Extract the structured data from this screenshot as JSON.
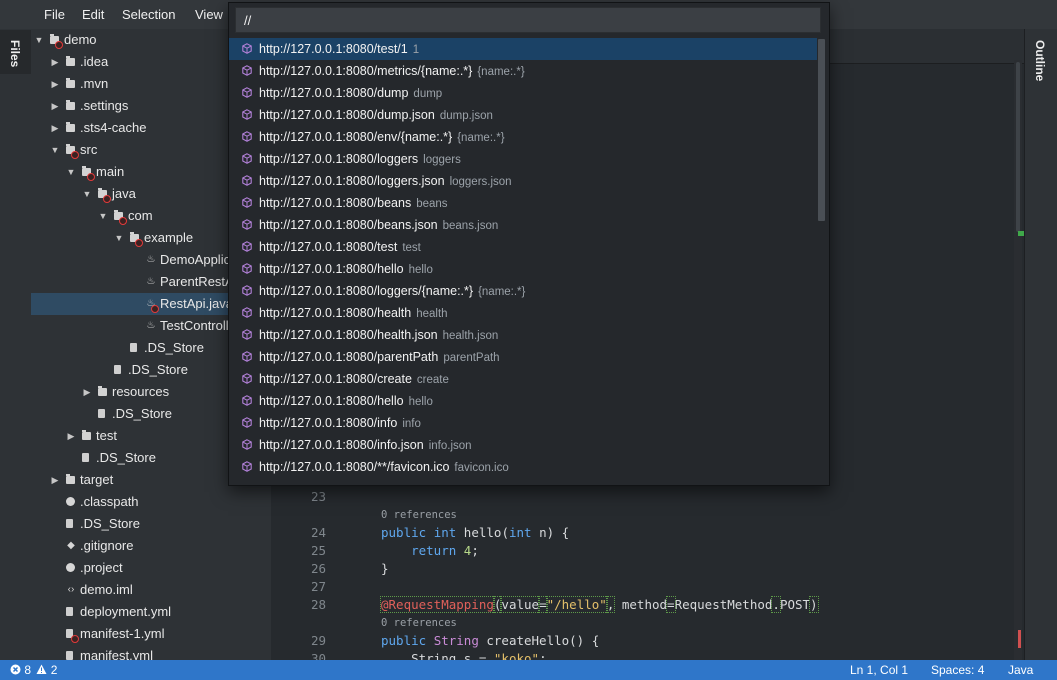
{
  "menu": [
    "File",
    "Edit",
    "Selection",
    "View"
  ],
  "sidebar": {
    "files_tab": "Files",
    "outline_tab": "Outline"
  },
  "tree": [
    {
      "label": "demo",
      "type": "folder",
      "twisty": "open",
      "error": true
    },
    {
      "label": ".idea",
      "type": "folder",
      "twisty": "closed"
    },
    {
      "label": ".mvn",
      "type": "folder",
      "twisty": "closed"
    },
    {
      "label": ".settings",
      "type": "folder",
      "twisty": "closed"
    },
    {
      "label": ".sts4-cache",
      "type": "folder",
      "twisty": "closed"
    },
    {
      "label": "src",
      "type": "folder",
      "twisty": "open",
      "error": true
    },
    {
      "label": "main",
      "type": "folder",
      "twisty": "open",
      "error": true
    },
    {
      "label": "java",
      "type": "folder",
      "twisty": "open",
      "error": true
    },
    {
      "label": "com",
      "type": "folder",
      "twisty": "open",
      "error": true
    },
    {
      "label": "example",
      "type": "folder",
      "twisty": "open",
      "error": true
    },
    {
      "label": "DemoApplic",
      "type": "java"
    },
    {
      "label": "ParentRestA",
      "type": "java"
    },
    {
      "label": "RestApi.java",
      "type": "java",
      "error": true,
      "selected": true
    },
    {
      "label": "TestControlle",
      "type": "java"
    },
    {
      "label": ".DS_Store",
      "type": "file"
    },
    {
      "label": ".DS_Store",
      "type": "file"
    },
    {
      "label": "resources",
      "type": "folder",
      "twisty": "closed"
    },
    {
      "label": ".DS_Store",
      "type": "file"
    },
    {
      "label": "test",
      "type": "folder",
      "twisty": "closed"
    },
    {
      "label": ".DS_Store",
      "type": "file"
    },
    {
      "label": "target",
      "type": "folder",
      "twisty": "closed"
    },
    {
      "label": ".classpath",
      "type": "dot"
    },
    {
      "label": ".DS_Store",
      "type": "file"
    },
    {
      "label": ".gitignore",
      "type": "git"
    },
    {
      "label": ".project",
      "type": "dot"
    },
    {
      "label": "demo.iml",
      "type": "code"
    },
    {
      "label": "deployment.yml",
      "type": "yml"
    },
    {
      "label": "manifest-1.yml",
      "type": "yml",
      "error": true
    },
    {
      "label": "manifest.yml",
      "type": "yml"
    }
  ],
  "code": {
    "refs_label": "0 references",
    "lines": [
      {
        "n": "23"
      },
      {
        "n": "24"
      },
      {
        "n": "25"
      },
      {
        "n": "26"
      },
      {
        "n": "27"
      },
      {
        "n": "28"
      },
      {
        "n": "29"
      },
      {
        "n": "30"
      }
    ],
    "tokens": {
      "public": "public",
      "int": "int",
      "hello": "hello",
      "int_n": "int",
      "params_n": " n) {",
      "return": "return",
      "four": "4",
      "close": "}",
      "annotation": "@RequestMapping",
      "value_key": "value",
      "value_str": "\"/hello\"",
      "method_key": "method",
      "request_method": "RequestMethod",
      "post": "POST",
      "string_type": "String",
      "create_hello": "createHello() {",
      "string_s": "String s = ",
      "koko": "\"koko\"",
      "semi": ";"
    }
  },
  "palette": {
    "query": "//",
    "items": [
      {
        "url": "http://127.0.0.1:8080/test/1",
        "desc": "1"
      },
      {
        "url": "http://127.0.0.1:8080/metrics/{name:.*}",
        "desc": "{name:.*}"
      },
      {
        "url": "http://127.0.0.1:8080/dump",
        "desc": "dump"
      },
      {
        "url": "http://127.0.0.1:8080/dump.json",
        "desc": "dump.json"
      },
      {
        "url": "http://127.0.0.1:8080/env/{name:.*}",
        "desc": "{name:.*}"
      },
      {
        "url": "http://127.0.0.1:8080/loggers",
        "desc": "loggers"
      },
      {
        "url": "http://127.0.0.1:8080/loggers.json",
        "desc": "loggers.json"
      },
      {
        "url": "http://127.0.0.1:8080/beans",
        "desc": "beans"
      },
      {
        "url": "http://127.0.0.1:8080/beans.json",
        "desc": "beans.json"
      },
      {
        "url": "http://127.0.0.1:8080/test",
        "desc": "test"
      },
      {
        "url": "http://127.0.0.1:8080/hello",
        "desc": "hello"
      },
      {
        "url": "http://127.0.0.1:8080/loggers/{name:.*}",
        "desc": "{name:.*}"
      },
      {
        "url": "http://127.0.0.1:8080/health",
        "desc": "health"
      },
      {
        "url": "http://127.0.0.1:8080/health.json",
        "desc": "health.json"
      },
      {
        "url": "http://127.0.0.1:8080/parentPath",
        "desc": "parentPath"
      },
      {
        "url": "http://127.0.0.1:8080/create",
        "desc": "create"
      },
      {
        "url": "http://127.0.0.1:8080/hello",
        "desc": "hello"
      },
      {
        "url": "http://127.0.0.1:8080/info",
        "desc": "info"
      },
      {
        "url": "http://127.0.0.1:8080/info.json",
        "desc": "info.json"
      },
      {
        "url": "http://127.0.0.1:8080/**/favicon.ico",
        "desc": "favicon.ico"
      }
    ]
  },
  "status": {
    "errors": "8",
    "warnings": "2",
    "position": "Ln 1, Col 1",
    "spaces": "Spaces: 4",
    "language": "Java"
  },
  "colors": {
    "status_bar": "#2f76c9",
    "selection": "#1b4266",
    "error_marker": "#e23a3a",
    "symbol_icon": "#b180d7"
  }
}
